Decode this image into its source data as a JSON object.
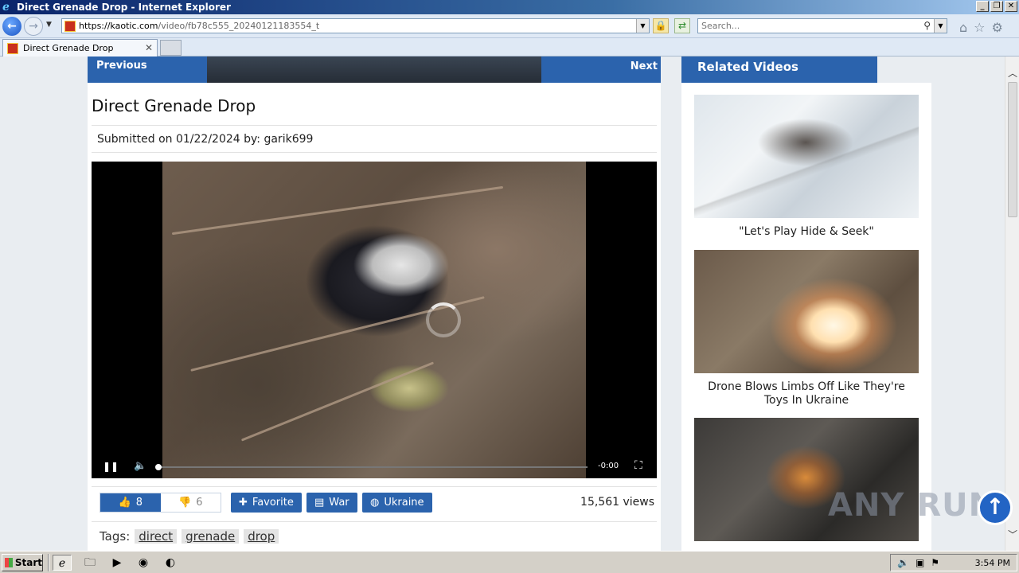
{
  "window": {
    "title": "Direct Grenade Drop - Internet Explorer"
  },
  "nav": {
    "url_host": "https://kaotic.com",
    "url_path": "/video/fb78c555_20240121183554_t",
    "search_placeholder": "Search..."
  },
  "tab": {
    "label": "Direct Grenade Drop"
  },
  "page": {
    "prev_label": "Previous",
    "next_label": "Next",
    "title": "Direct Grenade Drop",
    "submitted_prefix": "Submitted on 01/22/2024 by:",
    "submitted_user": "garik699",
    "player": {
      "time": "-0:00",
      "progress": 0
    },
    "likes": "8",
    "dislikes": "6",
    "favorite_label": "Favorite",
    "category_label": "War",
    "region_label": "Ukraine",
    "views": "15,561 views",
    "tags_label": "Tags:",
    "tags": [
      "direct",
      "grenade",
      "drop"
    ]
  },
  "sidebar": {
    "heading": "Related Videos",
    "videos": [
      {
        "caption": "\"Let's Play Hide & Seek\""
      },
      {
        "caption": "Drone Blows Limbs Off Like They're Toys In Ukraine"
      },
      {
        "caption": ""
      }
    ]
  },
  "watermark": {
    "text": "ANY RUN"
  },
  "taskbar": {
    "start_label": "Start",
    "clock": "3:54 PM"
  },
  "colors": {
    "accent": "#2b63ad",
    "titlebar": "#0a246a"
  }
}
